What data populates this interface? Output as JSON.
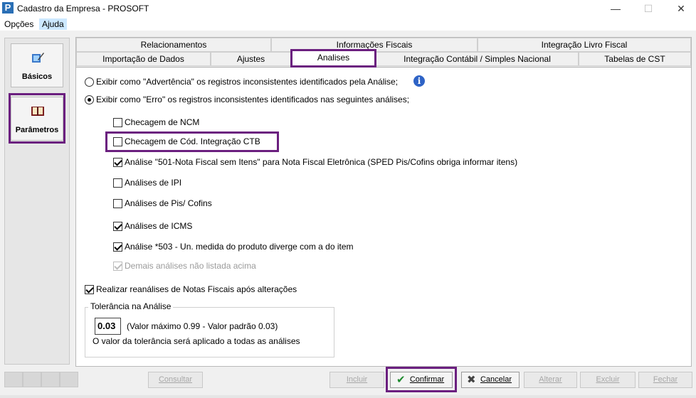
{
  "window": {
    "title": "Cadastro da Empresa - PROSOFT",
    "app_icon": "P"
  },
  "menu": {
    "items": [
      "Opções",
      "Ajuda"
    ]
  },
  "sidebar": {
    "items": [
      {
        "label": "Básicos",
        "icon": "edit-icon"
      },
      {
        "label": "Parâmetros",
        "icon": "book-icon"
      }
    ]
  },
  "tabs": {
    "row1": [
      "Relacionamentos",
      "Informações Fiscais",
      "Integração Livro Fiscal"
    ],
    "row2": [
      "Importação de Dados",
      "Ajustes",
      "Analises",
      "Integração Contábil / Simples Nacional",
      "Tabelas de CST"
    ],
    "active": "Analises"
  },
  "panel": {
    "radio_warning": "Exibir como \"Advertência\" os registros inconsistentes identificados pela Análise;",
    "radio_error": "Exibir como \"Erro\" os registros inconsistentes identificados nas seguintes análises;",
    "checks": [
      {
        "label": "Checagem de NCM",
        "checked": false
      },
      {
        "label": "Checagem de Cód. Integração CTB",
        "checked": false
      },
      {
        "label": "Análise \"501-Nota Fiscal sem Itens\" para Nota Fiscal Eletrônica (SPED Pis/Cofins obriga informar itens)",
        "checked": true
      },
      {
        "label": "Análises de IPI",
        "checked": false
      },
      {
        "label": "Análises de Pis/ Cofins",
        "checked": false
      },
      {
        "label": "Análises de ICMS",
        "checked": true
      },
      {
        "label": "Análise *503 - Un. medida do produto diverge com a do item",
        "checked": true
      },
      {
        "label": "Demais análises não listada acima",
        "checked": true,
        "disabled": true
      }
    ],
    "reanalyze": "Realizar reanálises de Notas Fiscais após alterações",
    "tolerance": {
      "title": "Tolerância na Análise",
      "value": "0.03",
      "hint": "(Valor máximo 0.99 - Valor padrão 0.03)",
      "note": "O valor da tolerância será aplicado a todas as análises"
    }
  },
  "buttons": {
    "consultar": "Consultar",
    "incluir": "Incluir",
    "confirmar": "Confirmar",
    "cancelar": "Cancelar",
    "alterar": "Alterar",
    "excluir": "Excluir",
    "fechar": "Fechar"
  },
  "colors": {
    "highlight": "#6b1f7f",
    "info_blue": "#2e63c6"
  }
}
